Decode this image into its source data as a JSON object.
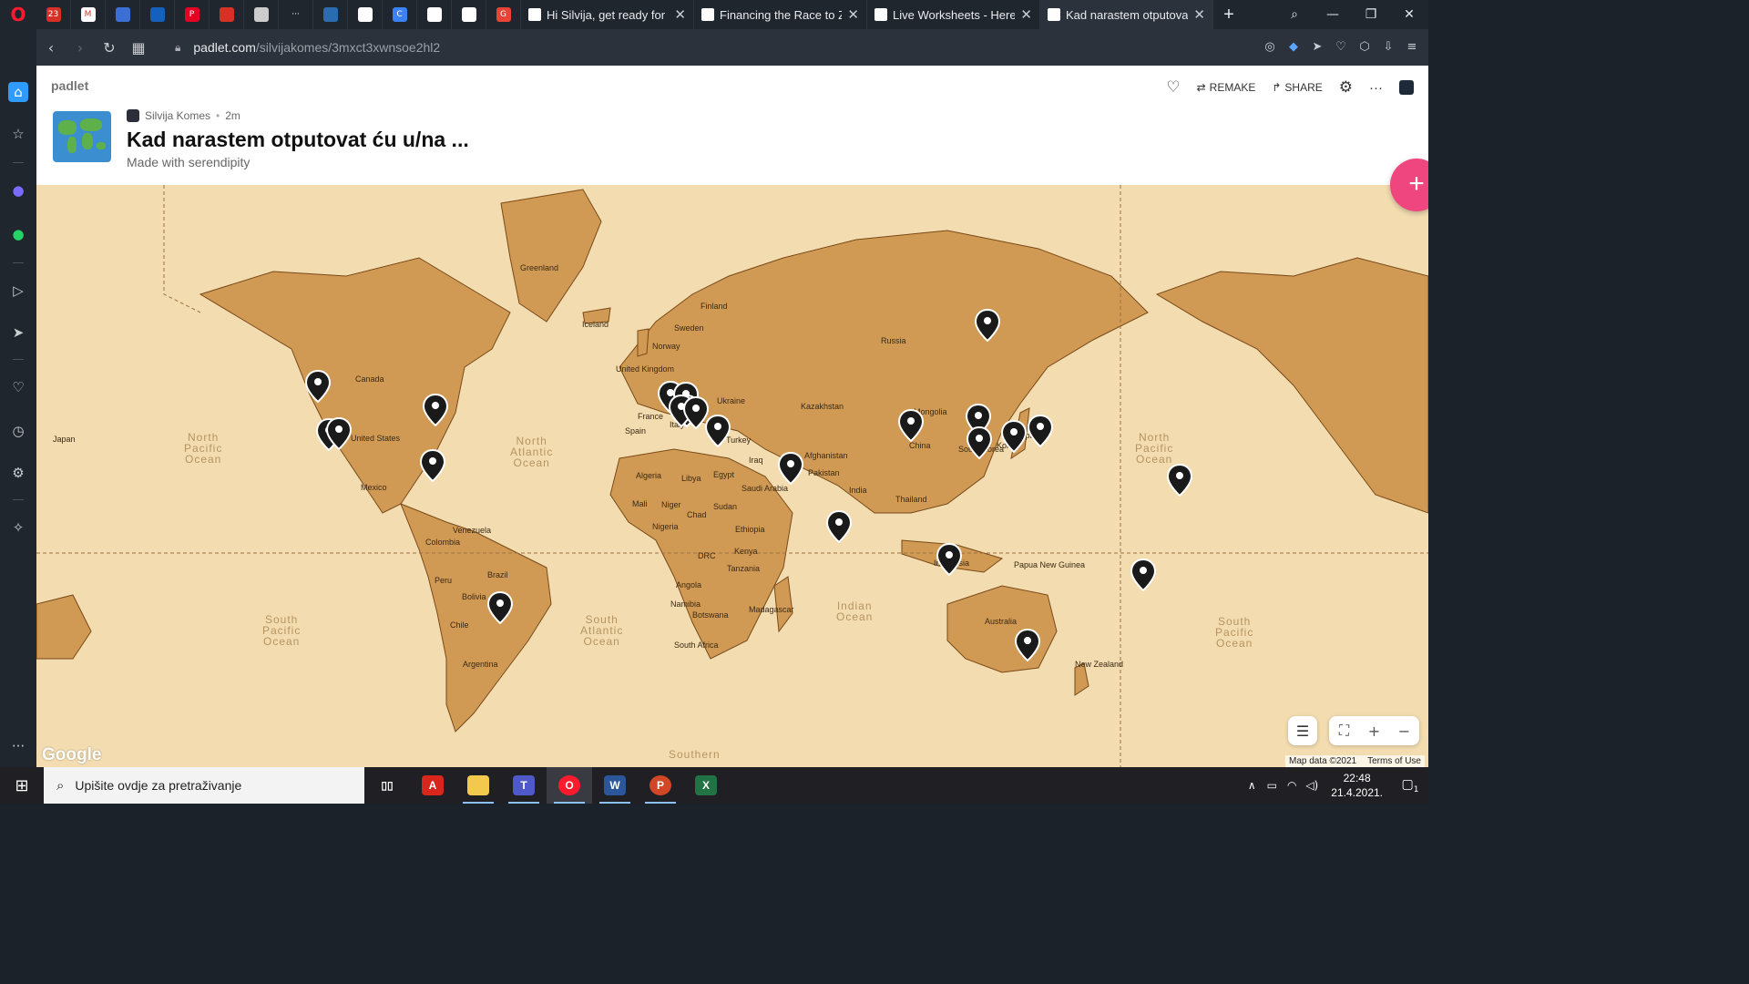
{
  "browser": {
    "pinned_tabs": [
      {
        "icon": "calendar-icon",
        "color": "#d93025",
        "text": "23"
      },
      {
        "icon": "gmail-icon",
        "color": "#ffffff",
        "text": "M"
      },
      {
        "icon": "link-icon",
        "color": "#3b6fd6",
        "text": ""
      },
      {
        "icon": "flag-icon",
        "color": "#1560bd",
        "text": ""
      },
      {
        "icon": "pinterest-icon",
        "color": "#e60023",
        "text": "P"
      },
      {
        "icon": "app-icon",
        "color": "#d93025",
        "text": ""
      },
      {
        "icon": "tool-icon",
        "color": "#cccccc",
        "text": ""
      },
      {
        "icon": "more-icon",
        "color": "#20262d",
        "text": "···"
      },
      {
        "icon": "globe-icon",
        "color": "#2a6cb0",
        "text": ""
      },
      {
        "icon": "page-icon",
        "color": "#ffffff",
        "text": ""
      },
      {
        "icon": "c-icon",
        "color": "#3b82f6",
        "text": "C"
      },
      {
        "icon": "mail-icon",
        "color": "#ffffff",
        "text": ""
      },
      {
        "icon": "lock-icon",
        "color": "#ffffff",
        "text": ""
      },
      {
        "icon": "g-icon",
        "color": "#ea4335",
        "text": "G"
      }
    ],
    "tabs": [
      {
        "title": "Hi Silvija, get ready for Ea",
        "active": false
      },
      {
        "title": "Financing the Race to Ze",
        "active": false
      },
      {
        "title": "Live Worksheets - Here y",
        "active": false
      },
      {
        "title": "Kad narastem otputovat",
        "active": true
      }
    ],
    "url_host": "padlet.com",
    "url_path": "/silvijakomes/3mxct3xwnsoe2hl2"
  },
  "padlet": {
    "brand": "padlet",
    "remake_label": "REMAKE",
    "share_label": "SHARE",
    "author": "Silvija Komes",
    "time_ago": "2m",
    "title": "Kad narastem otputovat ću u/na ...",
    "subtitle": "Made with serendipity",
    "fab_label": "+"
  },
  "map": {
    "labels": [
      "Greenland",
      "Iceland",
      "Finland",
      "Sweden",
      "Norway",
      "United Kingdom",
      "Russia",
      "Canada",
      "United States",
      "Mexico",
      "Japan",
      "Kazakhstan",
      "Mongolia",
      "China",
      "South Korea",
      "Ukraine",
      "France",
      "Spain",
      "Italy",
      "Turkey",
      "Iraq",
      "Afghanistan",
      "Pakistan",
      "India",
      "Thailand",
      "Algeria",
      "Libya",
      "Egypt",
      "Mali",
      "Niger",
      "Chad",
      "Sudan",
      "Nigeria",
      "Ethiopia",
      "Saudi Arabia",
      "Kenya",
      "DRC",
      "Tanzania",
      "Angola",
      "Namibia",
      "Botswana",
      "Madagascar",
      "South Africa",
      "Venezuela",
      "Colombia",
      "Peru",
      "Brazil",
      "Bolivia",
      "Chile",
      "Argentina",
      "Indonesia",
      "Papua New Guinea",
      "Australia",
      "New Zealand",
      "Korea",
      "Japan"
    ],
    "oceans": [
      "North\nPacific\nOcean",
      "North\nAtlantic\nOcean",
      "South\nPacific\nOcean",
      "South\nAtlantic\nOcean",
      "Indian\nOcean",
      "North\nPacific\nOcean",
      "South\nPacific\nOcean",
      "Southern"
    ],
    "pin_count": 24,
    "google_label": "Google",
    "map_data": "Map data ©2021",
    "terms": "Terms of Use"
  },
  "taskbar": {
    "search_placeholder": "Upišite ovdje za pretraživanje",
    "time": "22:48",
    "date": "21.4.2021.",
    "notification_count": "1"
  }
}
